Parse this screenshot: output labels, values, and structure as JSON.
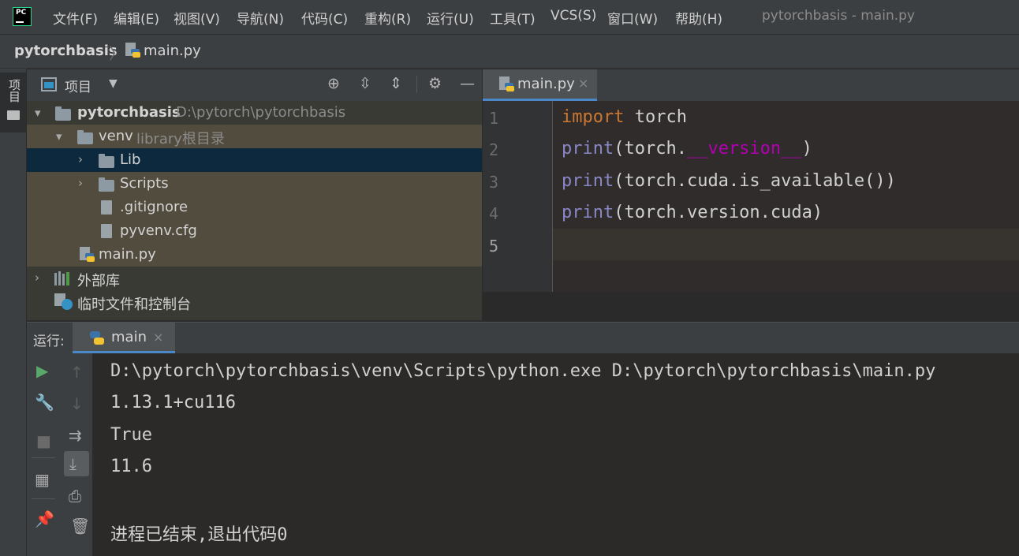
{
  "app": {
    "logo_text": "PC",
    "window_title": "pytorchbasis - main.py"
  },
  "menu": [
    {
      "label": "文件(F)"
    },
    {
      "label": "编辑(E)"
    },
    {
      "label": "视图(V)"
    },
    {
      "label": "导航(N)"
    },
    {
      "label": "代码(C)"
    },
    {
      "label": "重构(R)"
    },
    {
      "label": "运行(U)"
    },
    {
      "label": "工具(T)"
    },
    {
      "label": "VCS(S)"
    },
    {
      "label": "窗口(W)"
    },
    {
      "label": "帮助(H)"
    }
  ],
  "breadcrumb": {
    "project": "pytorchbasis",
    "file": "main.py"
  },
  "stripe": {
    "project_label": "项目"
  },
  "project_panel": {
    "title": "项目",
    "tree": [
      {
        "label": "pytorchbasis",
        "hint": "D:\\pytorch\\pytorchbasis"
      },
      {
        "label": "venv",
        "hint": "library根目录"
      },
      {
        "label": "Lib"
      },
      {
        "label": "Scripts"
      },
      {
        "label": ".gitignore"
      },
      {
        "label": "pyvenv.cfg"
      },
      {
        "label": "main.py"
      },
      {
        "label": "外部库"
      },
      {
        "label": "临时文件和控制台"
      }
    ]
  },
  "editor": {
    "tab": {
      "label": "main.py",
      "close": "×"
    },
    "line_numbers": [
      "1",
      "2",
      "3",
      "4",
      "5"
    ],
    "lines": [
      {
        "kw": "import",
        "rest": " torch"
      },
      {
        "fn": "print",
        "pre": "(torch.",
        "magic": "__version__",
        "post": ")"
      },
      {
        "fn": "print",
        "rest": "(torch.cuda.is_available())"
      },
      {
        "fn": "print",
        "rest": "(torch.version.cuda)"
      }
    ]
  },
  "run_panel": {
    "label": "运行:",
    "tab": {
      "label": "main",
      "close": "×"
    },
    "output": [
      "D:\\pytorch\\pytorchbasis\\venv\\Scripts\\python.exe D:\\pytorch\\pytorchbasis\\main.py",
      "1.13.1+cu116",
      "True",
      "11.6",
      "进程已结束,退出代码0"
    ]
  }
}
